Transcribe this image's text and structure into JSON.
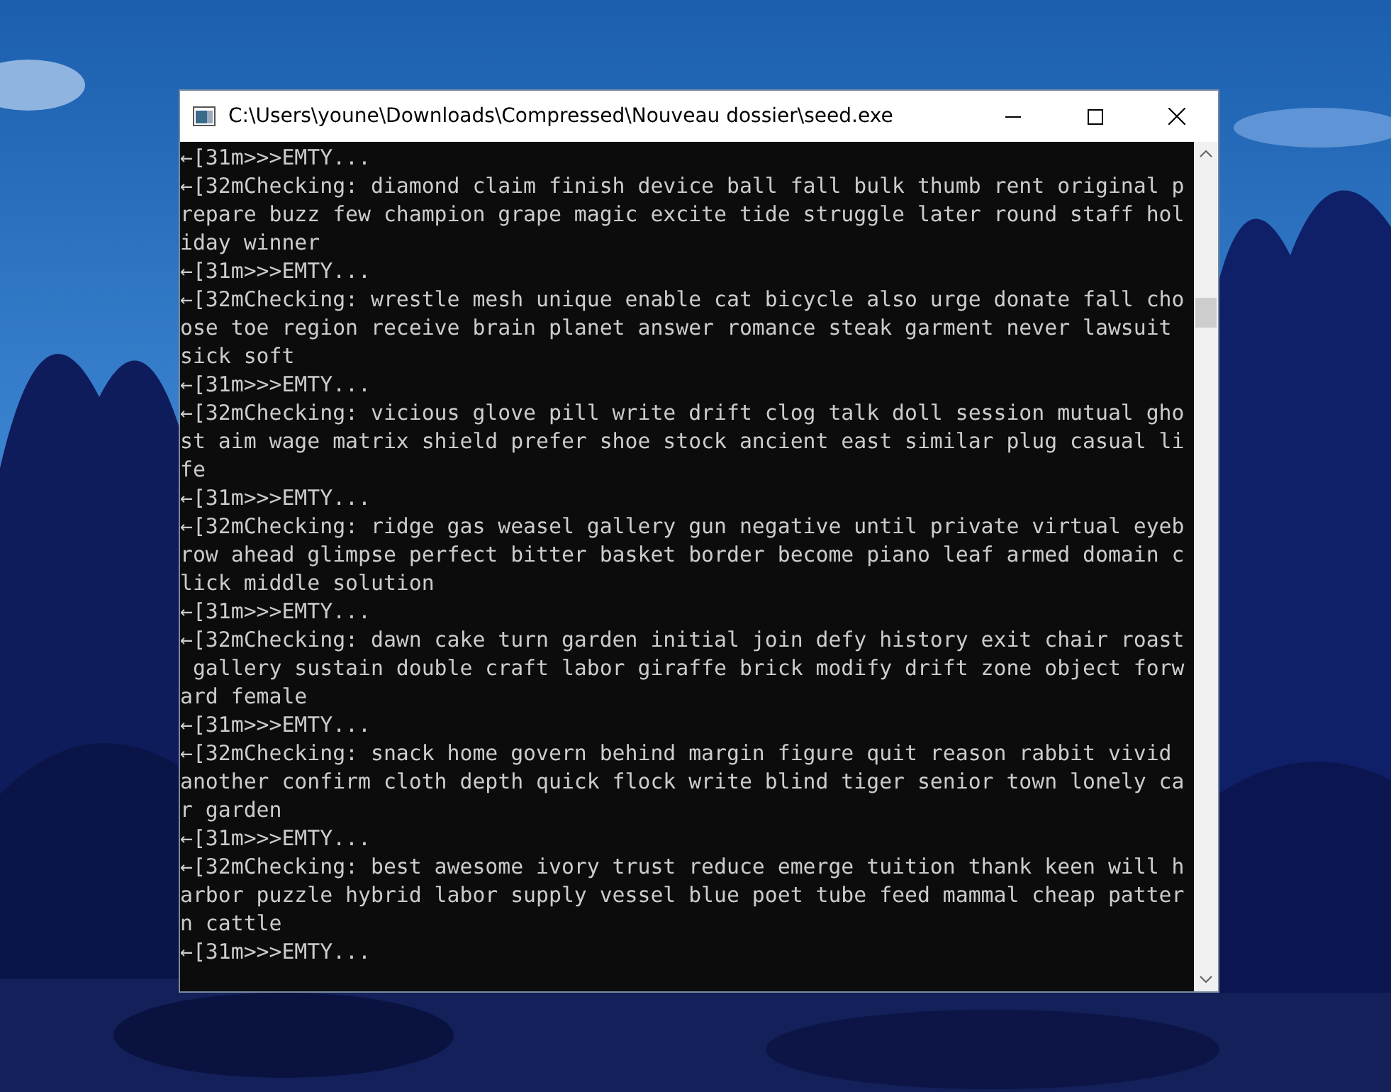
{
  "window": {
    "title": "C:\\Users\\youne\\Downloads\\Compressed\\Nouveau dossier\\seed.exe"
  },
  "console": {
    "lines": [
      "←[31m>>>EMTY...",
      "←[32mChecking: diamond claim finish device ball fall bulk thumb rent original p",
      "repare buzz few champion grape magic excite tide struggle later round staff hol",
      "iday winner",
      "←[31m>>>EMTY...",
      "←[32mChecking: wrestle mesh unique enable cat bicycle also urge donate fall cho",
      "ose toe region receive brain planet answer romance steak garment never lawsuit",
      "sick soft",
      "←[31m>>>EMTY...",
      "←[32mChecking: vicious glove pill write drift clog talk doll session mutual gho",
      "st aim wage matrix shield prefer shoe stock ancient east similar plug casual li",
      "fe",
      "←[31m>>>EMTY...",
      "←[32mChecking: ridge gas weasel gallery gun negative until private virtual eyeb",
      "row ahead glimpse perfect bitter basket border become piano leaf armed domain c",
      "lick middle solution",
      "←[31m>>>EMTY...",
      "←[32mChecking: dawn cake turn garden initial join defy history exit chair roast",
      " gallery sustain double craft labor giraffe brick modify drift zone object forw",
      "ard female",
      "←[31m>>>EMTY...",
      "←[32mChecking: snack home govern behind margin figure quit reason rabbit vivid",
      "another confirm cloth depth quick flock write blind tiger senior town lonely ca",
      "r garden",
      "←[31m>>>EMTY...",
      "←[32mChecking: best awesome ivory trust reduce emerge tuition thank keen will h",
      "arbor puzzle hybrid labor supply vessel blue poet tube feed mammal cheap patter",
      "n cattle",
      "←[31m>>>EMTY..."
    ]
  }
}
